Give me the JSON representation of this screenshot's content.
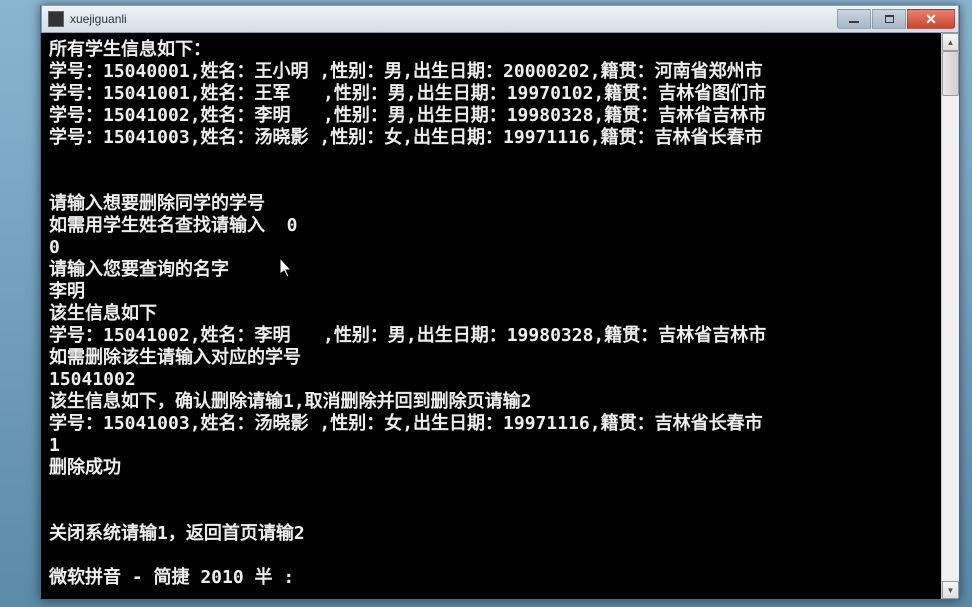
{
  "window": {
    "title": "xuejiguanli"
  },
  "console": {
    "header": "所有学生信息如下：",
    "students": [
      "学号：15040001,姓名：王小明 ,性别：男,出生日期：20000202,籍贯：河南省郑州市",
      "学号：15041001,姓名：王军   ,性别：男,出生日期：19970102,籍贯：吉林省图们市",
      "学号：15041002,姓名：李明   ,性别：男,出生日期：19980328,籍贯：吉林省吉林市",
      "学号：15041003,姓名：汤晓影 ,性别：女,出生日期：19971116,籍贯：吉林省长春市"
    ],
    "prompt_delete_id": "请输入想要删除同学的学号",
    "prompt_name_search": "如需用学生姓名查找请输入  0",
    "input_zero": "0",
    "prompt_enter_name": "请输入您要查询的名字",
    "input_name": "李明",
    "info_header": "该生信息如下",
    "found_student": "学号：15041002,姓名：李明   ,性别：男,出生日期：19980328,籍贯：吉林省吉林市",
    "prompt_delete_confirm": "如需删除该生请输入对应的学号",
    "input_id": "15041002",
    "confirm_header": "该生信息如下，确认删除请输1,取消删除并回到删除页请输2",
    "confirm_student": "学号：15041003,姓名：汤晓影 ,性别：女,出生日期：19971116,籍贯：吉林省长春市",
    "input_confirm": "1",
    "success_msg": "删除成功",
    "exit_prompt": "关闭系统请输1，返回首页请输2",
    "ime_status": "微软拼音 - 简捷 2010 半 :"
  }
}
